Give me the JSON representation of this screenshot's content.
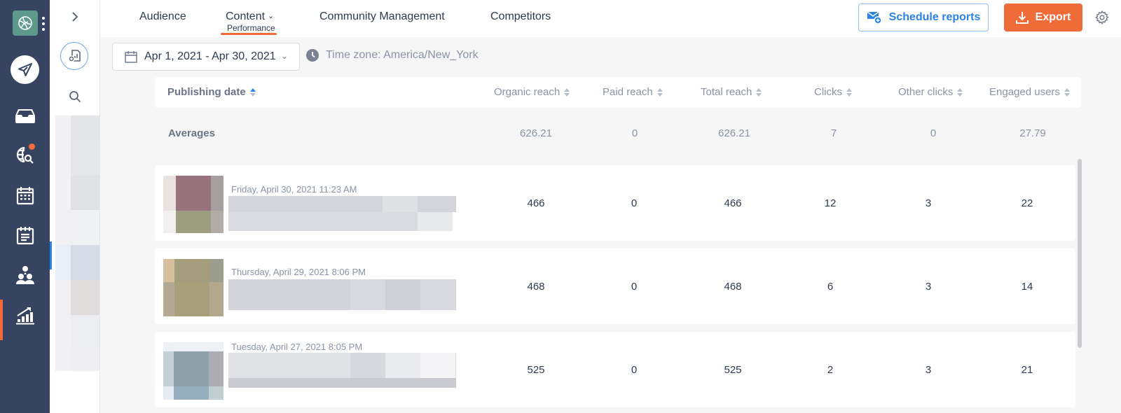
{
  "nav_rail": {
    "items": [
      {
        "name": "publish",
        "icon": "paper-plane-icon"
      },
      {
        "name": "inbox",
        "icon": "inbox-tray-icon"
      },
      {
        "name": "listening",
        "icon": "globe-search-icon",
        "has_notification": true
      },
      {
        "name": "calendar",
        "icon": "calendar-icon"
      },
      {
        "name": "planner",
        "icon": "notepad-icon"
      },
      {
        "name": "team",
        "icon": "users-group-icon"
      },
      {
        "name": "analytics",
        "icon": "bar-chart-trend-icon",
        "active": true
      }
    ],
    "accent_color": "#f26b3a"
  },
  "header": {
    "tabs": [
      {
        "label": "Audience"
      },
      {
        "label": "Content",
        "sublabel": "Performance",
        "active": true,
        "has_dropdown": true
      },
      {
        "label": "Community Management"
      },
      {
        "label": "Competitors"
      }
    ],
    "schedule_button": "Schedule reports",
    "export_button": "Export",
    "colors": {
      "primary_blue": "#2a83e6",
      "export_orange": "#ef6c38"
    }
  },
  "filters": {
    "date_range": "Apr 1, 2021 - Apr 30, 2021",
    "timezone": "Time zone: America/New_York"
  },
  "table": {
    "columns": [
      {
        "label": "Publishing date",
        "sorted": "asc"
      },
      {
        "label": "Organic reach"
      },
      {
        "label": "Paid reach"
      },
      {
        "label": "Total reach"
      },
      {
        "label": "Clicks"
      },
      {
        "label": "Other clicks"
      },
      {
        "label": "Engaged users"
      }
    ],
    "averages": {
      "label": "Averages",
      "values": [
        "626.21",
        "0",
        "626.21",
        "7",
        "0",
        "27.79"
      ]
    },
    "rows": [
      {
        "date": "Friday, April 30, 2021 11:23 AM",
        "values": [
          "466",
          "0",
          "466",
          "12",
          "3",
          "22"
        ]
      },
      {
        "date": "Thursday, April 29, 2021 8:06 PM",
        "values": [
          "468",
          "0",
          "468",
          "6",
          "3",
          "14"
        ]
      },
      {
        "date": "Tuesday, April 27, 2021 8:05 PM",
        "values": [
          "525",
          "0",
          "525",
          "2",
          "3",
          "21"
        ]
      }
    ]
  }
}
